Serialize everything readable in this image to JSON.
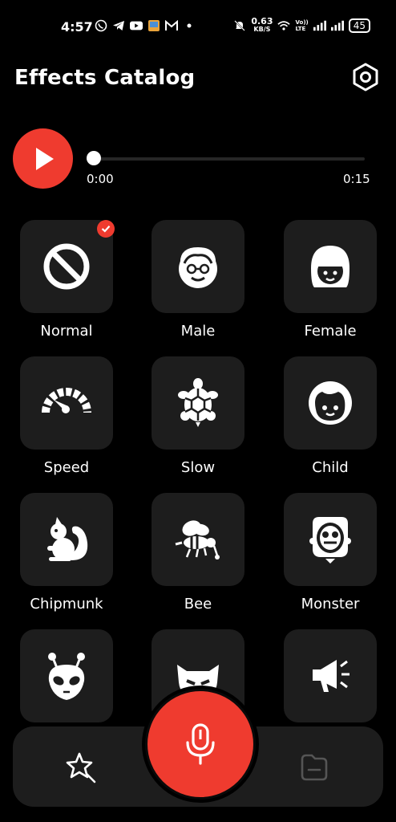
{
  "status_bar": {
    "time": "4:57",
    "speed": "0.63",
    "speed_unit": "KB/S",
    "battery": "45",
    "volte": "Vo))\nLTE",
    "icons": [
      "whatsapp-icon",
      "telegram-icon",
      "youtube-icon",
      "gallery-icon",
      "gmail-icon",
      "dot-icon",
      "mute-icon",
      "wifi-icon",
      "signal-icon",
      "signal-icon-2",
      "battery-icon"
    ]
  },
  "header": {
    "title": "Effects Catalog"
  },
  "player": {
    "current_time": "0:00",
    "total_time": "0:15",
    "progress": 0
  },
  "effects": [
    {
      "label": "Normal",
      "icon": "ban-icon",
      "selected": true
    },
    {
      "label": "Male",
      "icon": "male-face-icon",
      "selected": false
    },
    {
      "label": "Female",
      "icon": "female-face-icon",
      "selected": false
    },
    {
      "label": "Speed",
      "icon": "speedometer-icon",
      "selected": false
    },
    {
      "label": "Slow",
      "icon": "turtle-icon",
      "selected": false
    },
    {
      "label": "Child",
      "icon": "child-face-icon",
      "selected": false
    },
    {
      "label": "Chipmunk",
      "icon": "squirrel-icon",
      "selected": false
    },
    {
      "label": "Bee",
      "icon": "bee-icon",
      "selected": false
    },
    {
      "label": "Monster",
      "icon": "monster-icon",
      "selected": false
    },
    {
      "label": "",
      "icon": "alien-icon",
      "selected": false
    },
    {
      "label": "",
      "icon": "devil-icon",
      "selected": false
    },
    {
      "label": "",
      "icon": "megaphone-icon",
      "selected": false
    }
  ],
  "colors": {
    "accent": "#ef3b2f",
    "tile": "#1d1d1d",
    "background": "#000000"
  }
}
